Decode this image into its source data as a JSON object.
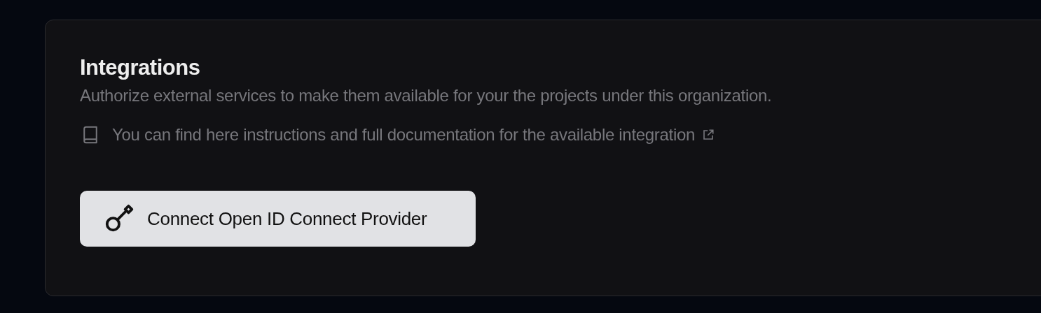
{
  "section": {
    "title": "Integrations",
    "description": "Authorize external services to make them available for your the projects under this organization.",
    "docs_link": "You can find here instructions and full documentation for the available integration"
  },
  "button": {
    "label": "Connect Open ID Connect Provider"
  }
}
